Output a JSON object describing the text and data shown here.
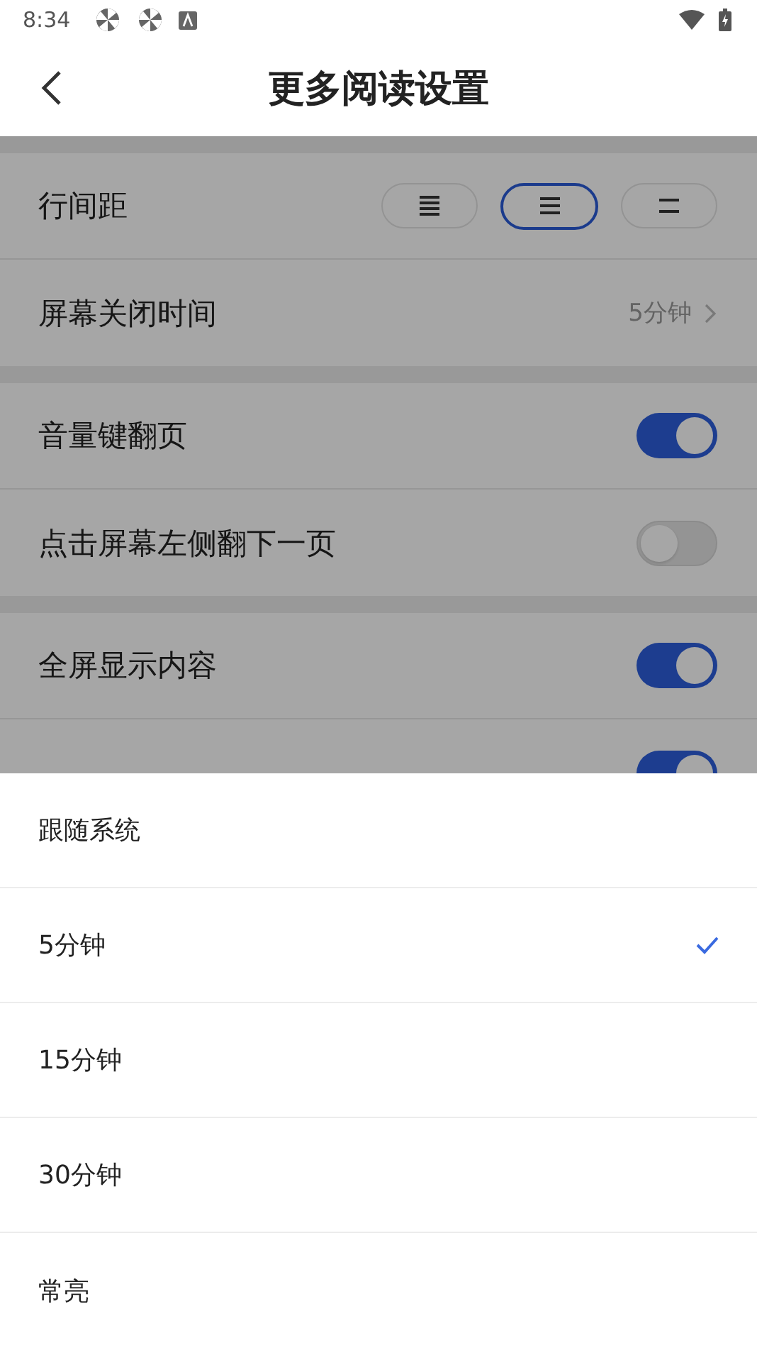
{
  "status_bar": {
    "time": "8:34"
  },
  "header": {
    "title": "更多阅读设置"
  },
  "sections": [
    {
      "rows": [
        {
          "kind": "spacing",
          "label": "行间距",
          "options": [
            {
              "kind": "dense",
              "selected": false
            },
            {
              "kind": "normal",
              "selected": true
            },
            {
              "kind": "loose",
              "selected": false
            }
          ]
        },
        {
          "kind": "value",
          "label": "屏幕关闭时间",
          "value": "5分钟"
        }
      ]
    },
    {
      "rows": [
        {
          "kind": "toggle",
          "label": "音量键翻页",
          "on": true
        },
        {
          "kind": "toggle",
          "label": "点击屏幕左侧翻下一页",
          "on": false
        }
      ]
    },
    {
      "rows": [
        {
          "kind": "toggle",
          "label": "全屏显示内容",
          "on": true
        },
        {
          "kind": "toggle",
          "on": true
        }
      ]
    }
  ],
  "sheet": {
    "options": [
      {
        "label": "跟随系统",
        "selected": false
      },
      {
        "label": "5分钟",
        "selected": true
      },
      {
        "label": "15分钟",
        "selected": false
      },
      {
        "label": "30分钟",
        "selected": false
      },
      {
        "label": "常亮",
        "selected": false
      }
    ]
  }
}
